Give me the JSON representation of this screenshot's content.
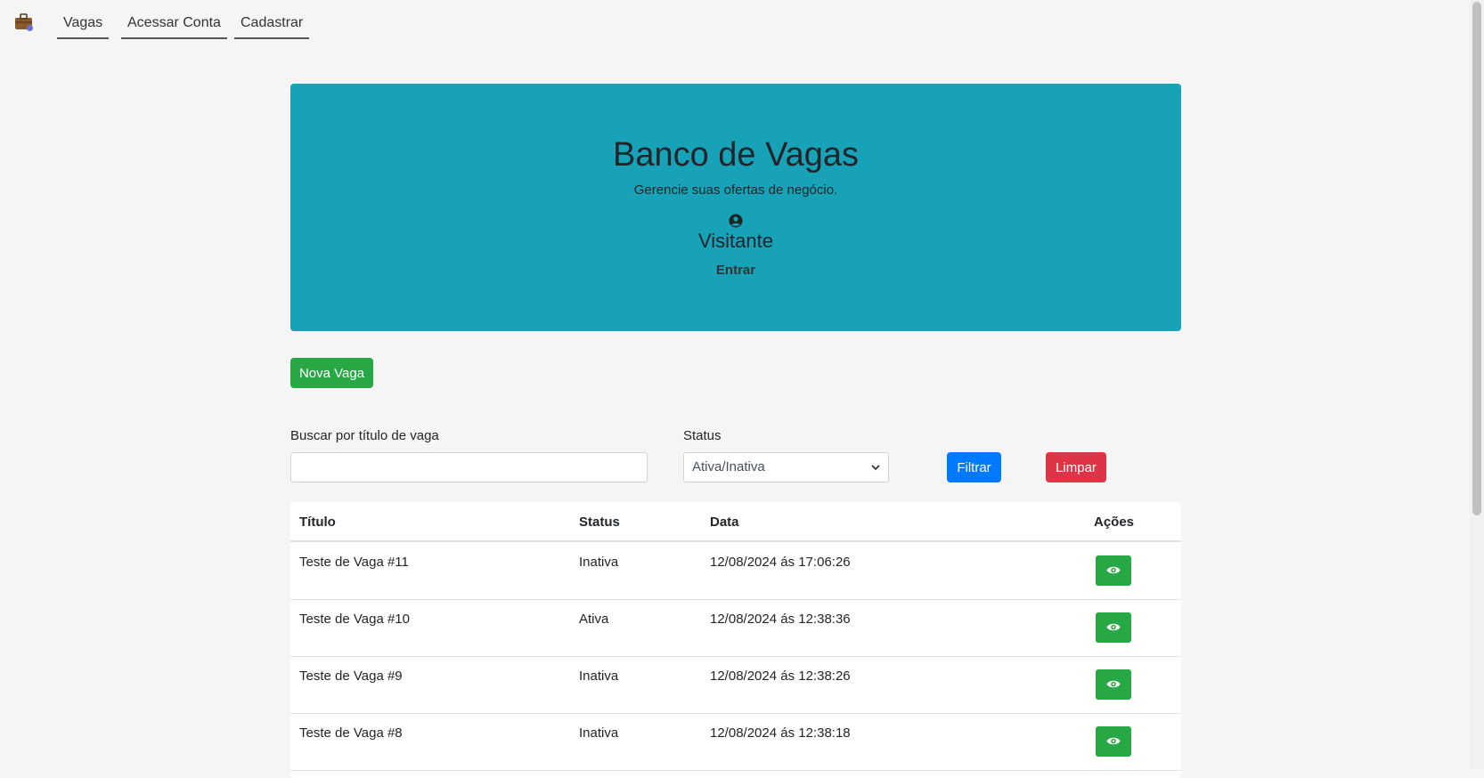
{
  "nav": {
    "logo_icon": "briefcase-icon",
    "links": [
      "Vagas",
      "Acessar Conta",
      "Cadastrar"
    ]
  },
  "hero": {
    "title": "Banco de Vagas",
    "subtitle": "Gerencie suas ofertas de negócio.",
    "user_icon": "user-circle-icon",
    "user_name": "Visitante",
    "login_label": "Entrar",
    "bg_color": "#17a2b8"
  },
  "actions": {
    "new_job_label": "Nova Vaga"
  },
  "filters": {
    "search_label": "Buscar por título de vaga",
    "search_value": "",
    "status_label": "Status",
    "status_selected": "Ativa/Inativa",
    "filter_label": "Filtrar",
    "clear_label": "Limpar"
  },
  "table": {
    "headers": [
      "Título",
      "Status",
      "Data",
      "Ações"
    ],
    "rows": [
      {
        "title": "Teste de Vaga #11",
        "status": "Inativa",
        "date": "12/08/2024 ás 17:06:26",
        "action_icon": "eye-icon"
      },
      {
        "title": "Teste de Vaga #10",
        "status": "Ativa",
        "date": "12/08/2024 ás 12:38:36",
        "action_icon": "eye-icon"
      },
      {
        "title": "Teste de Vaga #9",
        "status": "Inativa",
        "date": "12/08/2024 ás 12:38:26",
        "action_icon": "eye-icon"
      },
      {
        "title": "Teste de Vaga #8",
        "status": "Inativa",
        "date": "12/08/2024 ás 12:38:18",
        "action_icon": "eye-icon"
      }
    ]
  },
  "colors": {
    "success": "#28a745",
    "primary": "#007bff",
    "danger": "#dc3545"
  }
}
